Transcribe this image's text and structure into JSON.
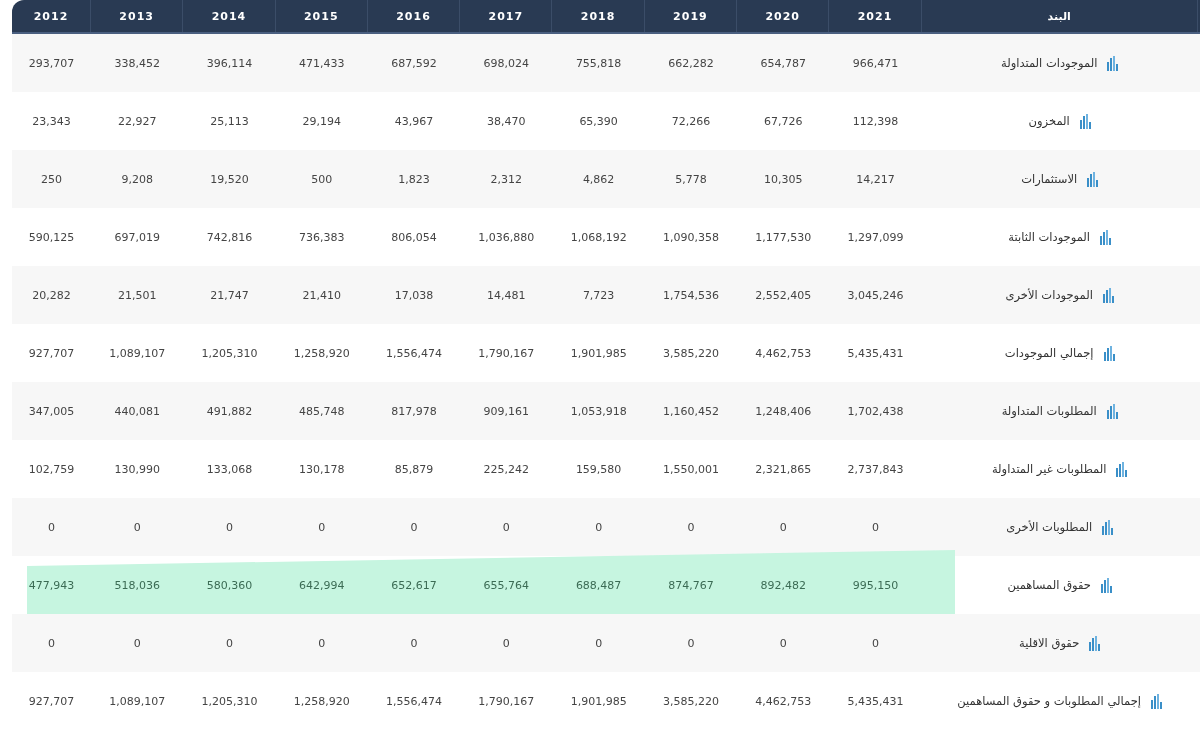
{
  "table": {
    "years": [
      "2012",
      "2013",
      "2014",
      "2015",
      "2016",
      "2017",
      "2018",
      "2019",
      "2020",
      "2021"
    ],
    "label_header": "البند",
    "rows": [
      {
        "values": [
          "293,707",
          "338,452",
          "396,114",
          "471,433",
          "687,592",
          "698,024",
          "755,818",
          "662,282",
          "654,787",
          "966,471"
        ],
        "label": "الموجودات المتداولة",
        "highlighted": false
      },
      {
        "values": [
          "23,343",
          "22,927",
          "25,113",
          "29,194",
          "43,967",
          "38,470",
          "65,390",
          "72,266",
          "67,726",
          "112,398"
        ],
        "label": "المخزون",
        "highlighted": false
      },
      {
        "values": [
          "250",
          "9,208",
          "19,520",
          "500",
          "1,823",
          "2,312",
          "4,862",
          "5,778",
          "10,305",
          "14,217"
        ],
        "label": "الاستثمارات",
        "highlighted": false
      },
      {
        "values": [
          "590,125",
          "697,019",
          "742,816",
          "736,383",
          "806,054",
          "1,036,880",
          "1,068,192",
          "1,090,358",
          "1,177,530",
          "1,297,099"
        ],
        "label": "الموجودات الثابتة",
        "highlighted": false
      },
      {
        "values": [
          "20,282",
          "21,501",
          "21,747",
          "21,410",
          "17,038",
          "14,481",
          "7,723",
          "1,754,536",
          "2,552,405",
          "3,045,246"
        ],
        "label": "الموجودات الأخرى",
        "highlighted": false
      },
      {
        "values": [
          "927,707",
          "1,089,107",
          "1,205,310",
          "1,258,920",
          "1,556,474",
          "1,790,167",
          "1,901,985",
          "3,585,220",
          "4,462,753",
          "5,435,431"
        ],
        "label": "إجمالي الموجودات",
        "highlighted": false
      },
      {
        "values": [
          "347,005",
          "440,081",
          "491,882",
          "485,748",
          "817,978",
          "909,161",
          "1,053,918",
          "1,160,452",
          "1,248,406",
          "1,702,438"
        ],
        "label": "المطلوبات المتداولة",
        "highlighted": false
      },
      {
        "values": [
          "102,759",
          "130,990",
          "133,068",
          "130,178",
          "85,879",
          "225,242",
          "159,580",
          "1,550,001",
          "2,321,865",
          "2,737,843"
        ],
        "label": "المطلوبات غير المتداولة",
        "highlighted": false
      },
      {
        "values": [
          "0",
          "0",
          "0",
          "0",
          "0",
          "0",
          "0",
          "0",
          "0",
          "0"
        ],
        "label": "المطلوبات الأخرى",
        "highlighted": false
      },
      {
        "values": [
          "477,943",
          "518,036",
          "580,360",
          "642,994",
          "652,617",
          "655,764",
          "688,487",
          "874,767",
          "892,482",
          "995,150"
        ],
        "label": "حقوق المساهمين",
        "highlighted": true
      },
      {
        "values": [
          "0",
          "0",
          "0",
          "0",
          "0",
          "0",
          "0",
          "0",
          "0",
          "0"
        ],
        "label": "حقوق الاقلية",
        "highlighted": false
      },
      {
        "values": [
          "927,707",
          "1,089,107",
          "1,205,310",
          "1,258,920",
          "1,556,474",
          "1,790,167",
          "1,901,985",
          "3,585,220",
          "4,462,753",
          "5,435,431"
        ],
        "label": "إجمالي المطلوبات و حقوق المساهمين",
        "highlighted": false
      }
    ]
  }
}
